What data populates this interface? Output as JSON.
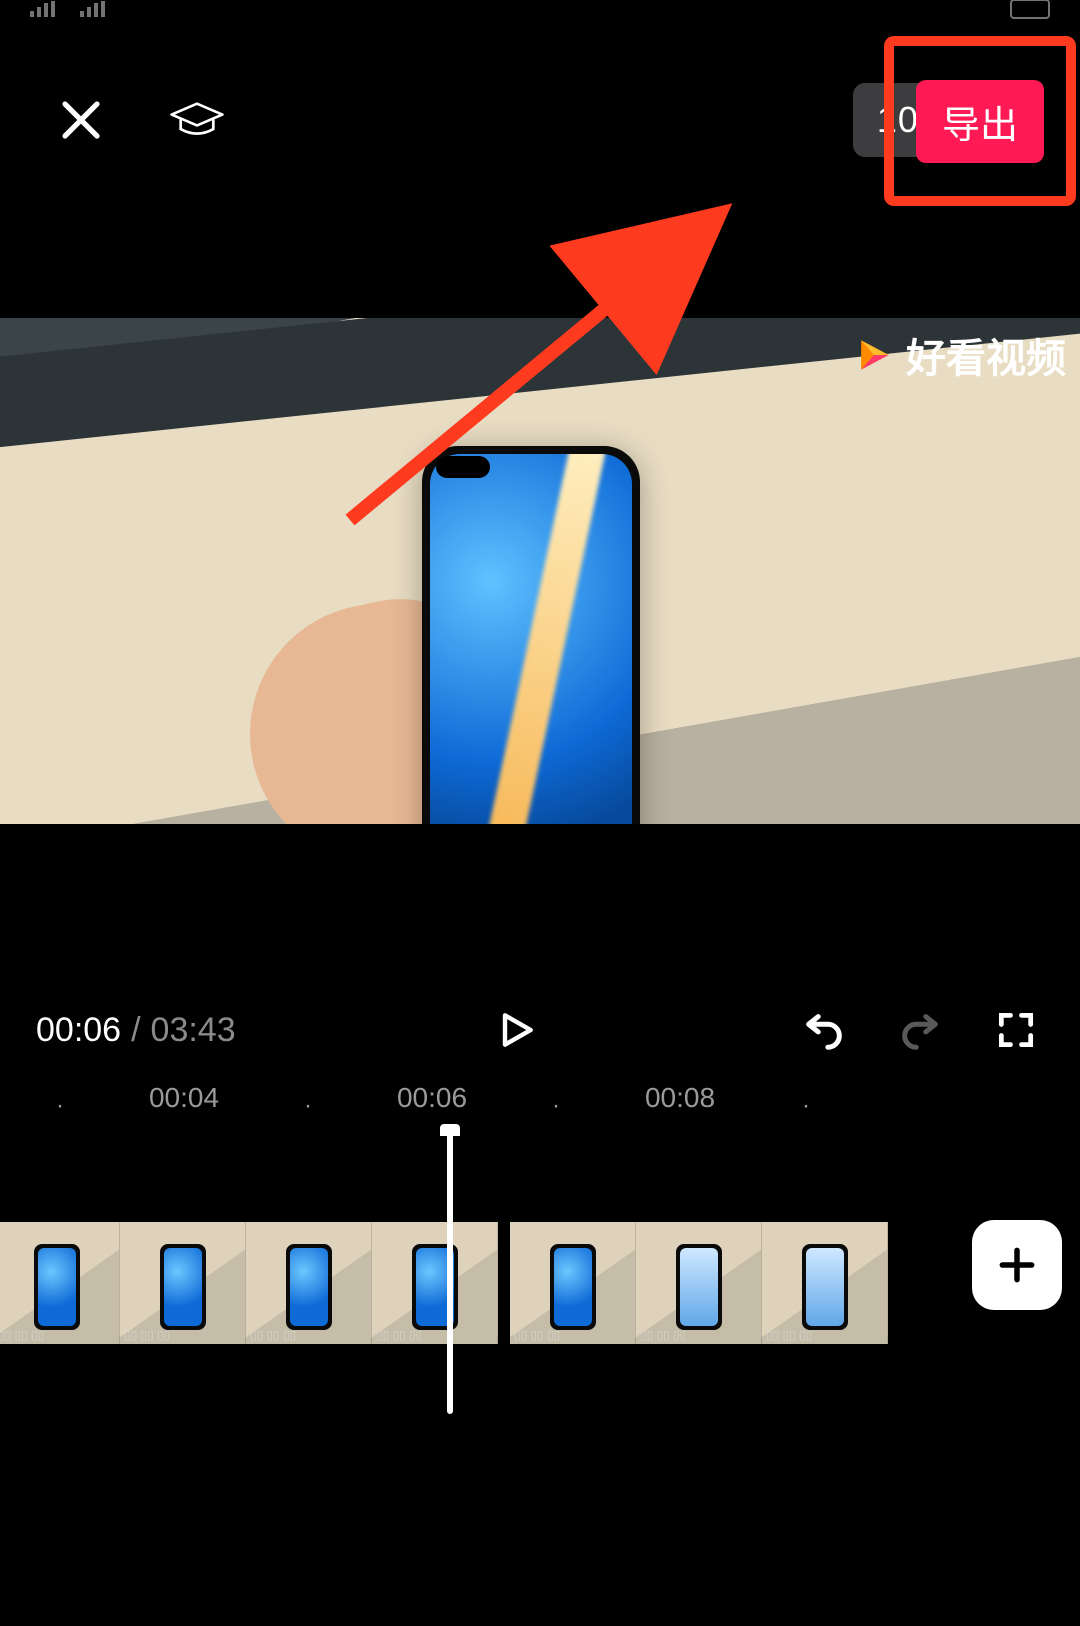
{
  "toolbar": {
    "resolution_label": "1080P",
    "export_label": "导出"
  },
  "preview": {
    "watermark_text": "好看视频"
  },
  "playback": {
    "current_time": "00:06",
    "separator": "/",
    "total_time": "03:43"
  },
  "ruler": {
    "ticks": [
      "00:04",
      "00:06",
      "00:08"
    ]
  },
  "icons": {
    "close": "close-icon",
    "help": "graduation-cap-icon",
    "play": "play-icon",
    "undo": "undo-icon",
    "redo": "redo-icon",
    "fullscreen": "fullscreen-icon",
    "add": "plus-icon",
    "caret": "caret-down-icon"
  }
}
